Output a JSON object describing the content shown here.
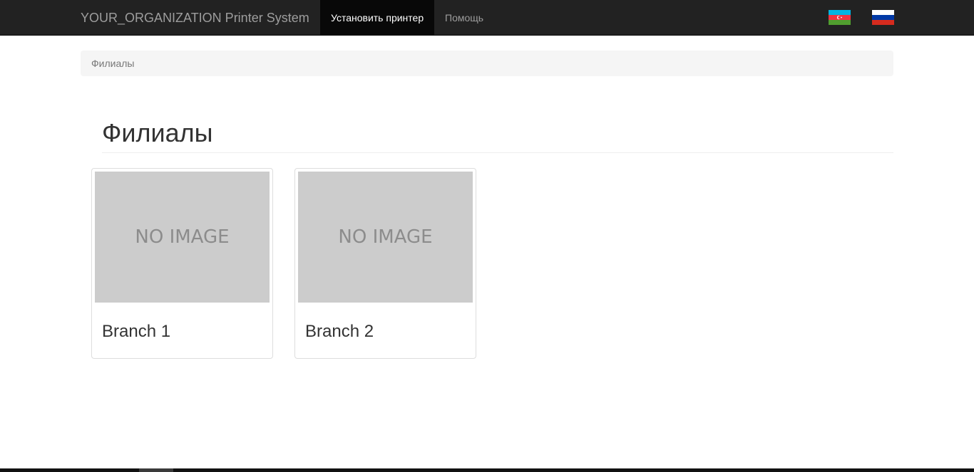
{
  "navbar": {
    "brand": "YOUR_ORGANIZATION Printer System",
    "items": [
      {
        "label": "Установить принтер",
        "active": true
      },
      {
        "label": "Помощь",
        "active": false
      }
    ],
    "languages": [
      {
        "code": "az",
        "icon": "azerbaijan-flag-icon"
      },
      {
        "code": "ru",
        "icon": "russia-flag-icon"
      }
    ]
  },
  "breadcrumb": {
    "items": [
      "Филиалы"
    ]
  },
  "page": {
    "title": "Филиалы"
  },
  "branches": [
    {
      "image_text": "NO IMAGE",
      "name": "Branch 1"
    },
    {
      "image_text": "NO IMAGE",
      "name": "Branch 2"
    }
  ],
  "colors": {
    "navbar_bg": "#222222",
    "active_nav_bg": "#080808",
    "placeholder_bg": "#cccccc",
    "breadcrumb_bg": "#f5f5f5"
  }
}
